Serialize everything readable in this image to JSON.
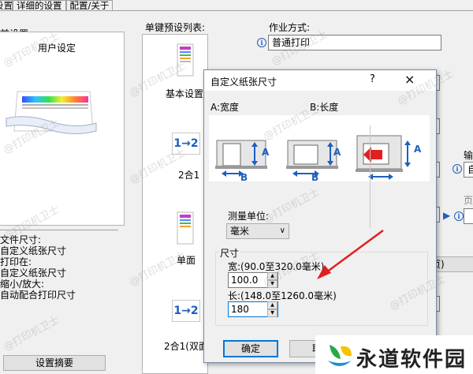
{
  "tabs": [
    {
      "label": "设置"
    },
    {
      "label": "详细的设置"
    },
    {
      "label": "配置/关于"
    }
  ],
  "left": {
    "current_settings": "前设置",
    "user_setting": "用户设定",
    "info_lines": [
      "文件尺寸:",
      "自定义纸张尺寸",
      "打印在:",
      "自定义纸张尺寸",
      "缩小/放大:",
      "自动配合打印尺寸"
    ],
    "summary_button": "设置摘要"
  },
  "presets": {
    "list_label": "单键预设列表:",
    "items": [
      {
        "label": "基本设置"
      },
      {
        "label": "2合1",
        "icon_text": "1→2"
      },
      {
        "label": "单面"
      },
      {
        "label": "2合1(双面",
        "icon_text": "1→2"
      }
    ]
  },
  "right": {
    "work_mode_label": "作业方式:",
    "work_mode_value": "普通打印",
    "output_label": "输",
    "output_value": "自",
    "page_label": "页",
    "flip_label": "翻页)"
  },
  "dialog": {
    "title": "自定义纸张尺寸",
    "help": "?",
    "close": "×",
    "width_caption": "A:宽度",
    "length_caption": "B:长度",
    "letter_a": "A",
    "letter_b": "B",
    "unit_label": "测量单位:",
    "unit_value": "毫米",
    "size_group": "尺寸",
    "width_label": "宽:(90.0至320.0毫米)",
    "width_value": "100.0",
    "length_label": "长:(148.0至1260.0毫米)",
    "length_value": "180",
    "ok_button": "确定",
    "cancel_button": "取"
  },
  "watermark": "@打印机卫士",
  "logo": {
    "text": "永道软件园"
  },
  "colors": {
    "accent": "#1e5fbf",
    "arrow": "#e02020",
    "focus": "#0078d7"
  }
}
